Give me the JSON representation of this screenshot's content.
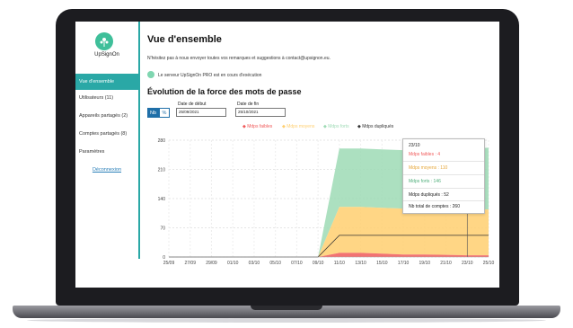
{
  "sidebar": {
    "app_name": "UpSignOn",
    "items": [
      {
        "label": "Vue d'ensemble"
      },
      {
        "label": "Utilisateurs (11)"
      },
      {
        "label": "Appareils partagés (2)"
      },
      {
        "label": "Comptes partagés (8)"
      },
      {
        "label": "Paramètres"
      }
    ],
    "logout_label": "Déconnexion"
  },
  "main": {
    "title": "Vue d'ensemble",
    "contact_text": "N'hésitez pas à nous envoyer toutes vos remarques et suggestions à contact@upsignon.eu.",
    "server_status": "Le serveur UpSignOn PRO est en cours d'exécution",
    "chart_title": "Évolution de la force des mots de passe",
    "toggle": {
      "nb": "Nb",
      "pct": "%"
    },
    "start_date": {
      "label": "Date de début",
      "value": "25/09/2021"
    },
    "end_date": {
      "label": "Date de fin",
      "value": "25/10/2021"
    }
  },
  "tooltip": {
    "date": "23/10",
    "weak": "Mdps faibles : 4",
    "medium": "Mdps moyens : 110",
    "strong": "Mdps forts : 146",
    "duplicated": "Mdps dupliqués : 52",
    "total": "Nb total de comptes : 260"
  },
  "colors": {
    "accent": "#2aa8a6",
    "weak": "#f05a5a",
    "medium": "#ffcf70",
    "strong": "#9edab5",
    "duplicated": "#333333"
  },
  "chart_data": {
    "type": "area",
    "x": [
      "25/09",
      "27/09",
      "29/09",
      "01/10",
      "03/10",
      "05/10",
      "07/10",
      "09/10",
      "11/10",
      "13/10",
      "15/10",
      "17/10",
      "19/10",
      "21/10",
      "23/10",
      "25/10"
    ],
    "ylim": [
      0,
      280
    ],
    "yticks": [
      0,
      70,
      140,
      210,
      280
    ],
    "legend_position": "top",
    "grid": true,
    "series": [
      {
        "name": "Mdps faibles",
        "color": "#f05a5a",
        "values": [
          0,
          0,
          0,
          0,
          0,
          0,
          0,
          0,
          10,
          10,
          8,
          6,
          6,
          5,
          4,
          4
        ]
      },
      {
        "name": "Mdps moyens",
        "color": "#ffcf70",
        "values": [
          0,
          0,
          0,
          0,
          0,
          0,
          0,
          0,
          110,
          110,
          110,
          110,
          110,
          110,
          110,
          110
        ]
      },
      {
        "name": "Mdps forts",
        "color": "#9edab5",
        "values": [
          0,
          0,
          0,
          0,
          0,
          0,
          0,
          0,
          140,
          140,
          140,
          140,
          142,
          144,
          146,
          148
        ]
      },
      {
        "name": "Mdps dupliqués",
        "color": "#333333",
        "values": [
          0,
          0,
          0,
          0,
          0,
          0,
          0,
          0,
          52,
          52,
          52,
          52,
          52,
          52,
          52,
          52
        ]
      }
    ]
  }
}
